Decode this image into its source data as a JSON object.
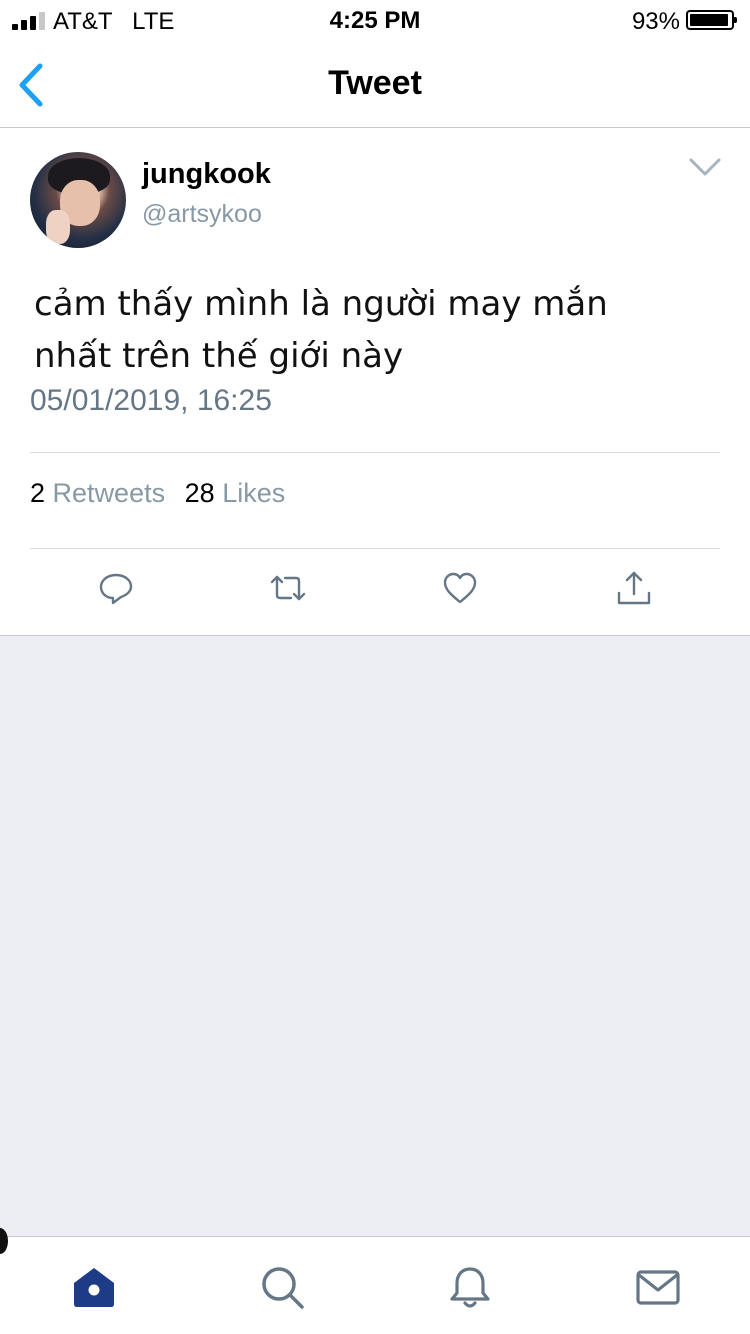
{
  "status_bar": {
    "carrier": "AT&T   LTE",
    "time": "4:25 PM",
    "battery": "93%",
    "battery_level": 0.93
  },
  "nav": {
    "title": "Tweet",
    "back_icon": "chevron-left-icon"
  },
  "tweet": {
    "display_name": "jungkook",
    "handle": "@artsykoo",
    "text_line1": "cảm thấy mình là người may mắn",
    "text_line2": "nhất trên thế giới này",
    "timestamp": "05/01/2019, 16:25",
    "retweets_count": "2",
    "retweets_label": "Retweets",
    "likes_count": "28",
    "likes_label": "Likes"
  },
  "actions": [
    "reply-icon",
    "retweet-icon",
    "like-icon",
    "share-icon"
  ],
  "tab_bar": [
    "home-icon",
    "search-icon",
    "notifications-icon",
    "messages-icon"
  ],
  "colors": {
    "accent": "#1da1f2",
    "tab_active": "#1d3b86",
    "secondary_text": "#8899a6",
    "background": "#edeef3"
  }
}
